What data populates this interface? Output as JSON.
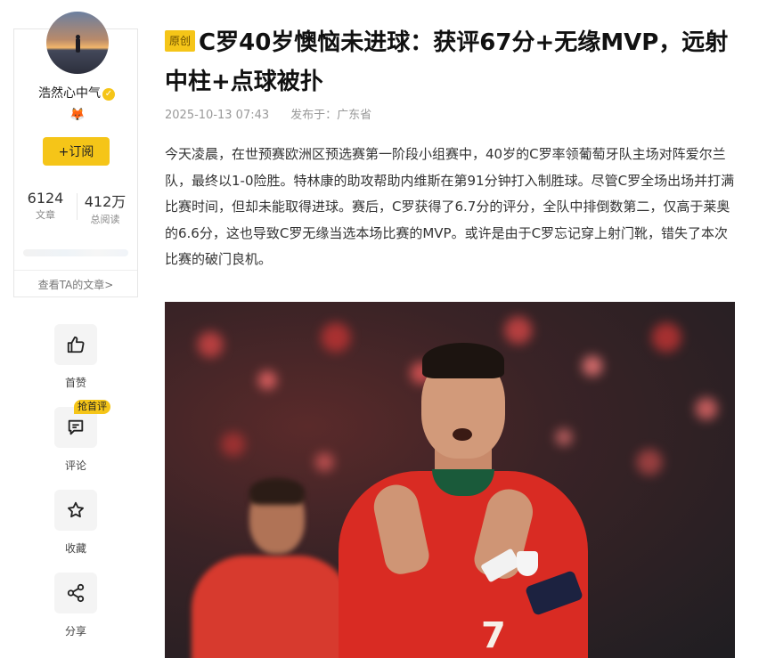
{
  "author": {
    "name": "浩然心中气",
    "verified_icon": "verified-check-icon",
    "badge_emoji": "🦊",
    "follow_label": "+订阅",
    "stats": [
      {
        "value": "6124",
        "label": "文章"
      },
      {
        "value": "412万",
        "label": "总阅读"
      }
    ],
    "view_articles_label": "查看TA的文章>"
  },
  "actions": [
    {
      "label": "首赞",
      "icon": "thumbs-up-icon"
    },
    {
      "label": "评论",
      "icon": "comment-icon",
      "badge": "抢首评"
    },
    {
      "label": "收藏",
      "icon": "star-icon"
    },
    {
      "label": "分享",
      "icon": "share-icon"
    }
  ],
  "article": {
    "tag": "原创",
    "title": "C罗40岁懊恼未进球：获评67分+无缘MVP，远射中柱+点球被扑",
    "date": "2025-10-13 07:43",
    "location": "发布于：广东省",
    "body": "今天凌晨，在世预赛欧洲区预选赛第一阶段小组赛中，40岁的C罗率领葡萄牙队主场对阵爱尔兰队，最终以1-0险胜。特林康的助攻帮助内维斯在第91分钟打入制胜球。尽管C罗全场出场并打满比赛时间，但却未能取得进球。赛后，C罗获得了6.7分的评分，全队中排倒数第二，仅高于莱奥的6.6分，这也导致C罗无缘当选本场比赛的MVP。或许是由于C罗忘记穿上射门靴，错失了本次比赛的破门良机。"
  },
  "photo": {
    "jersey_number": "7"
  },
  "colors": {
    "accent": "#f5c518",
    "text": "#222222",
    "muted": "#999999"
  }
}
